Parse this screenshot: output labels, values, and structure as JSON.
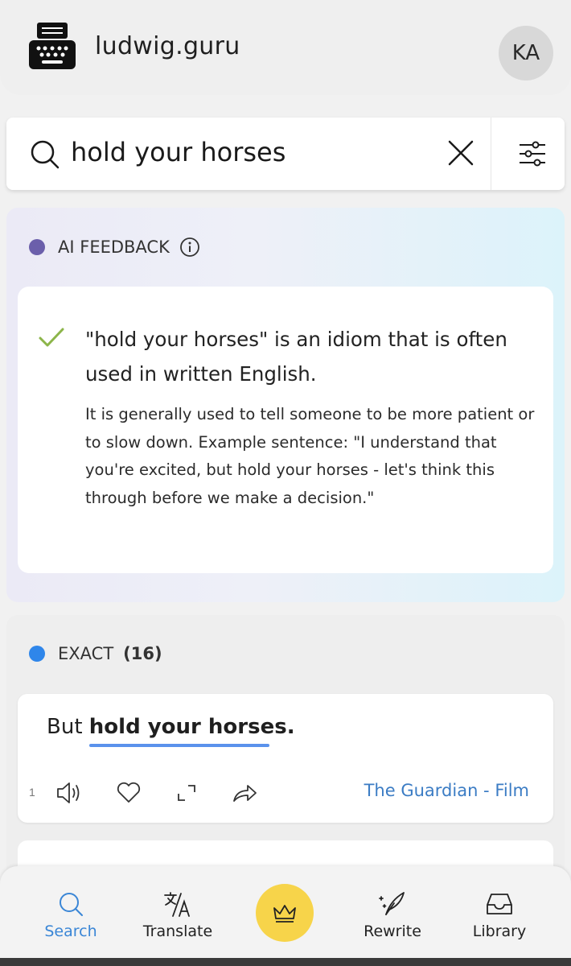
{
  "header": {
    "site_name": "ludwig.guru",
    "avatar_initials": "KA"
  },
  "search": {
    "query": "hold your horses"
  },
  "ai_feedback": {
    "label": "AI FEEDBACK",
    "dot_color": "#6b5fab",
    "headline": "\"hold your horses\" is an idiom that is often used in written English.",
    "body": "It is generally used to tell someone to be more patient or to slow down. Example sentence: \"I understand that you're excited, but hold your horses - let's think this through before we make a decision.\""
  },
  "exact": {
    "label": "EXACT",
    "count": "(16)",
    "dot_color": "#2f86ea",
    "results": [
      {
        "index": "1",
        "prefix": "But ",
        "highlight": "hold your horses.",
        "source": "The Guardian - Film"
      }
    ]
  },
  "nav": {
    "items": [
      {
        "label": "Search",
        "icon": "search-icon"
      },
      {
        "label": "Translate",
        "icon": "translate-icon"
      },
      {
        "label": "",
        "icon": "crown-icon"
      },
      {
        "label": "Rewrite",
        "icon": "quill-icon"
      },
      {
        "label": "Library",
        "icon": "inbox-icon"
      }
    ],
    "active_color": "#3a86d6",
    "premium_color": "#f7d44a"
  }
}
